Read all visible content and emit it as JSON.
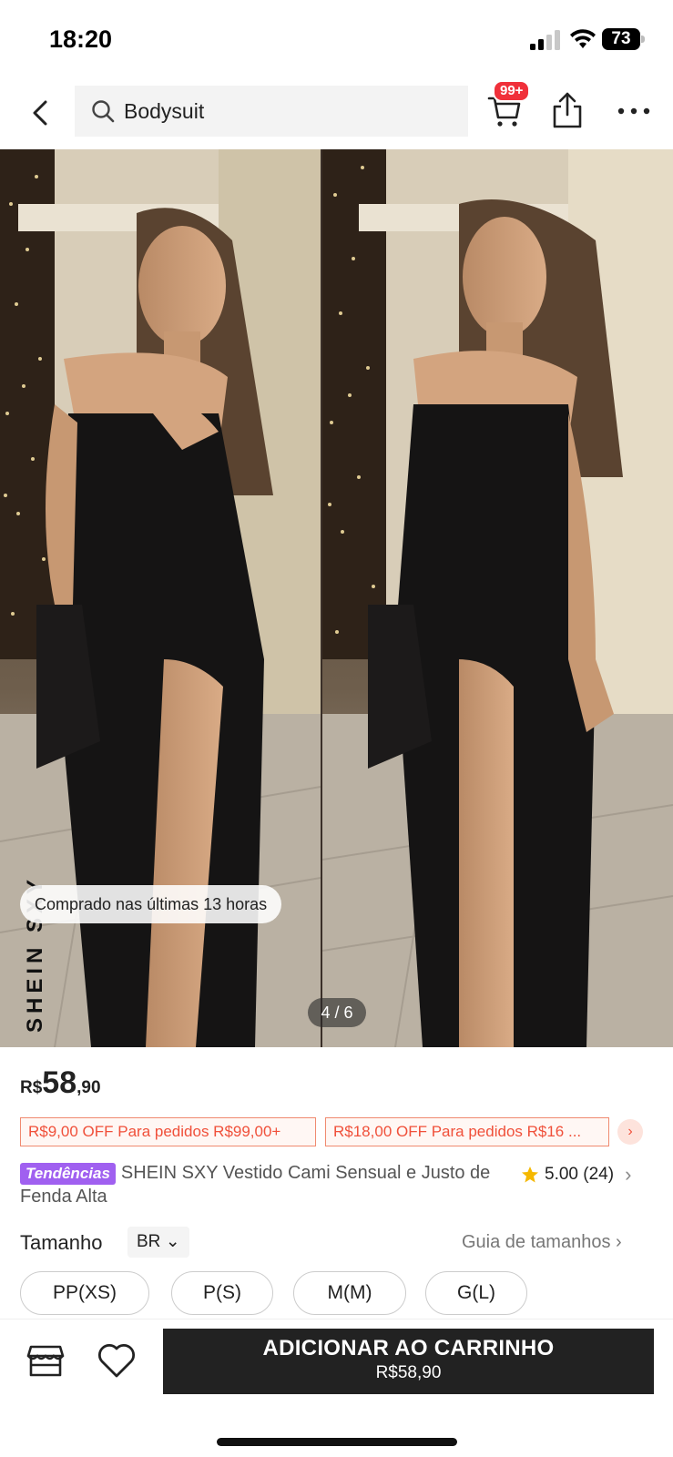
{
  "status_bar": {
    "time": "18:20",
    "battery": "73"
  },
  "header": {
    "search_text": "Bodysuit",
    "cart_badge": "99+"
  },
  "gallery": {
    "bought_text": "Comprado nas últimas  13 horas",
    "counter": "4 / 6",
    "watermark": "SHEIN",
    "brand_vertical": "SHEIN SXY"
  },
  "price": {
    "currency": "R$",
    "integer": "58",
    "decimal": ",90"
  },
  "coupons": [
    {
      "text": "R$9,00 OFF Para pedidos R$99,00+"
    },
    {
      "text": "R$18,00 OFF Para pedidos R$16 ..."
    }
  ],
  "product": {
    "badge": "Tendências",
    "title": "SHEIN SXY Vestido Cami Sensual e Justo de Fenda Alta",
    "rating": "5.00",
    "reviews": "(24)"
  },
  "size": {
    "label": "Tamanho",
    "region": "BR",
    "guide": "Guia de tamanhos",
    "options": [
      "PP(XS)",
      "P(S)",
      "M(M)",
      "G(L)"
    ]
  },
  "bottom_bar": {
    "add_label": "ADICIONAR AO CARRINHO",
    "add_price": "R$58,90"
  },
  "colors": {
    "accent": "#222222",
    "badge_red": "#f0303a",
    "coupon": "#f0503a",
    "trend": "#a060f0",
    "star": "#f5b800"
  }
}
